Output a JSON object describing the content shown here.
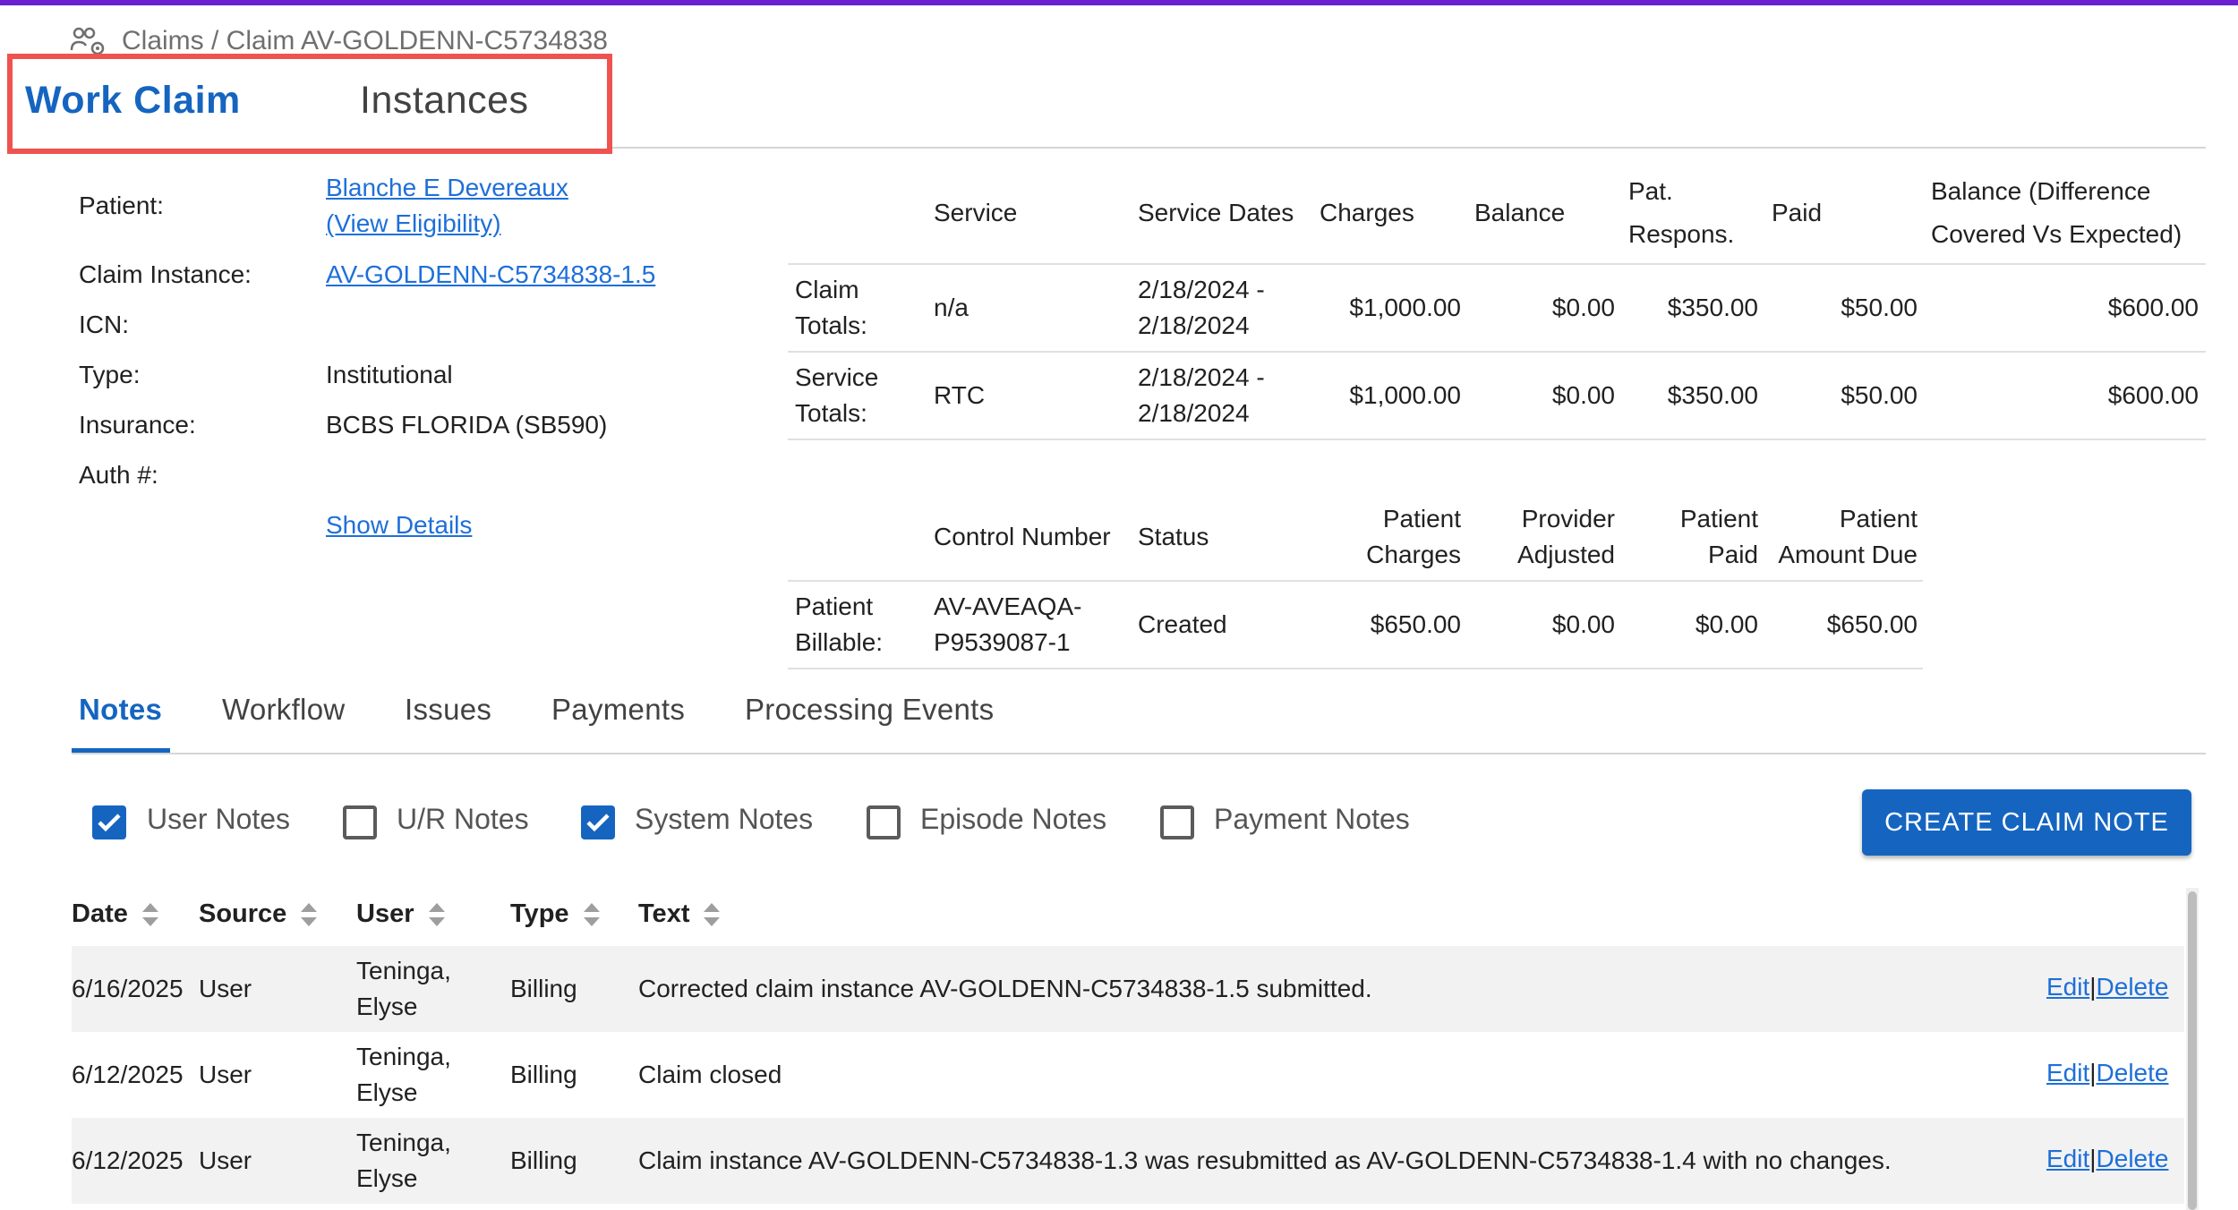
{
  "breadcrumb": {
    "icon": "people-gear-icon",
    "text": "Claims / Claim AV-GOLDENN-C5734838"
  },
  "main_tabs": [
    {
      "label": "Work Claim",
      "active": true
    },
    {
      "label": "Instances",
      "active": false
    }
  ],
  "patient_info": {
    "patient_label": "Patient:",
    "patient_name": "Blanche E Devereaux",
    "view_eligibility": "(View Eligibility)",
    "claim_instance_label": "Claim Instance:",
    "claim_instance": "AV-GOLDENN-C5734838-1.5",
    "icn_label": "ICN:",
    "type_label": "Type:",
    "type_value": "Institutional",
    "insurance_label": "Insurance:",
    "insurance_value": "BCBS FLORIDA (SB590)",
    "auth_label": "Auth #:",
    "show_details": "Show Details"
  },
  "totals_table": {
    "headers": {
      "service": "Service",
      "service_dates": "Service Dates",
      "charges": "Charges",
      "balance": "Balance",
      "pat_respons_1": "Pat.",
      "pat_respons_2": "Respons.",
      "paid": "Paid",
      "balance_diff_1": "Balance (Difference",
      "balance_diff_2": "Covered Vs Expected)"
    },
    "rows": [
      {
        "label1": "Claim",
        "label2": "Totals:",
        "service": "n/a",
        "date1": "2/18/2024 -",
        "date2": "2/18/2024",
        "charges": "$1,000.00",
        "balance": "$0.00",
        "pat_respons": "$350.00",
        "paid": "$50.00",
        "balance_diff": "$600.00"
      },
      {
        "label1": "Service",
        "label2": "Totals:",
        "service": "RTC",
        "date1": "2/18/2024 -",
        "date2": "2/18/2024",
        "charges": "$1,000.00",
        "balance": "$0.00",
        "pat_respons": "$350.00",
        "paid": "$50.00",
        "balance_diff": "$600.00"
      }
    ]
  },
  "patient_billable_table": {
    "headers": {
      "control_number": "Control Number",
      "status": "Status",
      "patient_charges_1": "Patient",
      "patient_charges_2": "Charges",
      "provider_adjusted_1": "Provider",
      "provider_adjusted_2": "Adjusted",
      "patient_paid_1": "Patient",
      "patient_paid_2": "Paid",
      "patient_amount_due_1": "Patient",
      "patient_amount_due_2": "Amount Due"
    },
    "row": {
      "label1": "Patient",
      "label2": "Billable:",
      "control1": "AV-AVEAQA-",
      "control2": "P9539087-1",
      "status": "Created",
      "patient_charges": "$650.00",
      "provider_adjusted": "$0.00",
      "patient_paid": "$0.00",
      "patient_amount_due": "$650.00"
    }
  },
  "sub_tabs": [
    {
      "label": "Notes",
      "active": true
    },
    {
      "label": "Workflow",
      "active": false
    },
    {
      "label": "Issues",
      "active": false
    },
    {
      "label": "Payments",
      "active": false
    },
    {
      "label": "Processing Events",
      "active": false
    }
  ],
  "filters": [
    {
      "label": "User Notes",
      "checked": true
    },
    {
      "label": "U/R Notes",
      "checked": false
    },
    {
      "label": "System Notes",
      "checked": true
    },
    {
      "label": "Episode Notes",
      "checked": false
    },
    {
      "label": "Payment Notes",
      "checked": false
    }
  ],
  "create_button": "CREATE CLAIM NOTE",
  "notes_table": {
    "columns": [
      "Date",
      "Source",
      "User",
      "Type",
      "Text"
    ],
    "rows": [
      {
        "date": "6/16/2025",
        "source": "User",
        "user1": "Teninga,",
        "user2": "Elyse",
        "type": "Billing",
        "text": "Corrected claim instance AV-GOLDENN-C5734838-1.5 submitted.",
        "edit": "Edit",
        "sep": "|",
        "delete": "Delete"
      },
      {
        "date": "6/12/2025",
        "source": "User",
        "user1": "Teninga,",
        "user2": "Elyse",
        "type": "Billing",
        "text": "Claim closed",
        "edit": "Edit",
        "sep": "|",
        "delete": "Delete"
      },
      {
        "date": "6/12/2025",
        "source": "User",
        "user1": "Teninga,",
        "user2": "Elyse",
        "type": "Billing",
        "text": "Claim instance AV-GOLDENN-C5734838-1.3 was resubmitted as AV-GOLDENN-C5734838-1.4 with no changes.",
        "edit": "Edit",
        "sep": "|",
        "delete": "Delete"
      }
    ]
  }
}
